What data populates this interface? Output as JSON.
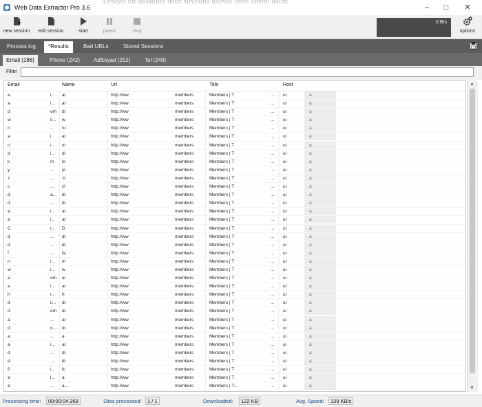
{
  "window": {
    "title": "Web Data Extractor Pro 3.6",
    "background_text": "Örnezii bir doktorun detrr sitvraina bauvur astre onemi decm",
    "minimize_glyph": "–",
    "maximize_glyph": "□",
    "close_glyph": "✕"
  },
  "toolbar": {
    "new_session": "new session",
    "edit_session": "edit session",
    "start": "start",
    "pause": "pause",
    "stop": "stop",
    "speed": "0 B/s",
    "options": "options"
  },
  "main_tabs": [
    {
      "label": "Process log",
      "active": false
    },
    {
      "label": "*Results",
      "active": true
    },
    {
      "label": "Bad URLs",
      "active": false
    },
    {
      "label": "Stored Sessions",
      "active": false
    }
  ],
  "result_tabs": [
    {
      "label": "Email (188)",
      "active": true
    },
    {
      "label": "Phone (242)",
      "active": false
    },
    {
      "label": "AdSoyad (252)",
      "active": false
    },
    {
      "label": "Tel (249)",
      "active": false
    }
  ],
  "filter": {
    "label": "Filter",
    "value": ""
  },
  "grid": {
    "columns": [
      "Email",
      "Name",
      "Url",
      "Title",
      "Host"
    ],
    "rows": [
      {
        "email": "a",
        "e2": "i...",
        "name": "al",
        "url": "http://ww",
        "u2": "members",
        "title": "Members | T",
        "t2": "...",
        "host": "ui",
        "h2": "a"
      },
      {
        "email": "a",
        "e2": "i...",
        "name": "al",
        "url": "http://ww",
        "u2": "members",
        "title": "Members | T",
        "t2": "...",
        "host": "ui",
        "h2": "a"
      },
      {
        "email": "d",
        "e2": "om",
        "name": "di",
        "url": "http://ww",
        "u2": "members",
        "title": "Members | T",
        "t2": "...",
        "host": "ui",
        "h2": "a"
      },
      {
        "email": "w",
        "e2": "il...",
        "name": "w",
        "url": "http://ww",
        "u2": "members",
        "title": "Members | T",
        "t2": "...",
        "host": "ui",
        "h2": "a"
      },
      {
        "email": "n",
        "e2": "...",
        "name": "ni",
        "url": "http://ww",
        "u2": "members",
        "title": "Members | T",
        "t2": "...",
        "host": "ui",
        "h2": "a"
      },
      {
        "email": "a",
        "e2": "i",
        "name": "al",
        "url": "http://ww",
        "u2": "members",
        "title": "Members | T",
        "t2": "...",
        "host": "ui",
        "h2": "a"
      },
      {
        "email": "n",
        "e2": "i...",
        "name": "m",
        "url": "http://ww",
        "u2": "members",
        "title": "Members | T",
        "t2": "...",
        "host": "ui",
        "h2": "a"
      },
      {
        "email": "d",
        "e2": "i...",
        "name": "di",
        "url": "http://ww",
        "u2": "members",
        "title": "Members | T",
        "t2": "...",
        "host": "ui",
        "h2": "a"
      },
      {
        "email": "k",
        "e2": "rn",
        "name": "lo",
        "url": "http://ww",
        "u2": "members",
        "title": "Members | T",
        "t2": "...",
        "host": "ui",
        "h2": "a"
      },
      {
        "email": "y",
        "e2": "...",
        "name": "yi",
        "url": "http://ww",
        "u2": "members",
        "title": "Members | T",
        "t2": "...",
        "host": "ui",
        "h2": "a"
      },
      {
        "email": "z",
        "e2": "...",
        "name": "zi",
        "url": "http://ww",
        "u2": "members",
        "title": "Members | T",
        "t2": "...",
        "host": "ui",
        "h2": "a"
      },
      {
        "email": "c",
        "e2": "...",
        "name": "cl",
        "url": "http://ww",
        "u2": "members",
        "title": "Members | T",
        "t2": "...",
        "host": "ui",
        "h2": "a"
      },
      {
        "email": "d",
        "e2": "a...",
        "name": "di",
        "url": "http://ww",
        "u2": "members",
        "title": "Members | T",
        "t2": "...",
        "host": "ui",
        "h2": "a"
      },
      {
        "email": "d",
        "e2": "...",
        "name": "di",
        "url": "http://ww",
        "u2": "members",
        "title": "Members | T",
        "t2": "...",
        "host": "ui",
        "h2": "a"
      },
      {
        "email": "a",
        "e2": "i...",
        "name": "al",
        "url": "http://ww",
        "u2": "members",
        "title": "Members | T",
        "t2": "...",
        "host": "ui",
        "h2": "a"
      },
      {
        "email": "a",
        "e2": "i...",
        "name": "al",
        "url": "http://ww",
        "u2": "members",
        "title": "Members | T",
        "t2": "...",
        "host": "ui",
        "h2": "a"
      },
      {
        "email": "C",
        "e2": "r...",
        "name": "D",
        "url": "http://ww",
        "u2": "members",
        "title": "Members | T",
        "t2": "...",
        "host": "ui",
        "h2": "a"
      },
      {
        "email": "d",
        "e2": "...",
        "name": "di",
        "url": "http://ww",
        "u2": "members",
        "title": "Members | T",
        "t2": "...",
        "host": "ui",
        "h2": "a"
      },
      {
        "email": "d",
        "e2": "...",
        "name": "di",
        "url": "http://ww",
        "u2": "members",
        "title": "Members | T",
        "t2": "...",
        "host": "ui",
        "h2": "a"
      },
      {
        "email": "f",
        "e2": "...",
        "name": "fa",
        "url": "http://ww",
        "u2": "members",
        "title": "Members | T",
        "t2": "...",
        "host": "ui",
        "h2": "a"
      },
      {
        "email": "n",
        "e2": "i...",
        "name": "m",
        "url": "http://ww",
        "u2": "members",
        "title": "Members | T",
        "t2": "...",
        "host": "ui",
        "h2": "a"
      },
      {
        "email": "w",
        "e2": "i...",
        "name": "w",
        "url": "http://ww",
        "u2": "members",
        "title": "Members | T",
        "t2": "...",
        "host": "ui",
        "h2": "a"
      },
      {
        "email": "a",
        "e2": "om",
        "name": "al",
        "url": "http://ww",
        "u2": "members",
        "title": "Members | T",
        "t2": "...",
        "host": "ui",
        "h2": "a"
      },
      {
        "email": "a",
        "e2": "i...",
        "name": "al",
        "url": "http://ww",
        "u2": "members",
        "title": "Members | T",
        "t2": "...",
        "host": "ui",
        "h2": "a"
      },
      {
        "email": "h",
        "e2": "r...",
        "name": "h",
        "url": "http://ww",
        "u2": "members",
        "title": "Members | T",
        "t2": "...",
        "host": "ui",
        "h2": "a"
      },
      {
        "email": "d",
        "e2": "il...",
        "name": "di",
        "url": "http://ww",
        "u2": "members",
        "title": "Members | T",
        "t2": "...",
        "host": "ui",
        "h2": "a"
      },
      {
        "email": "d",
        "e2": "om",
        "name": "di",
        "url": "http://ww",
        "u2": "members",
        "title": "Members | T",
        "t2": "...",
        "host": "ui",
        "h2": "a"
      },
      {
        "email": "a",
        "e2": "...",
        "name": "al",
        "url": "http://ww",
        "u2": "members",
        "title": "Members | T",
        "t2": "...",
        "host": "ui",
        "h2": "a"
      },
      {
        "email": "d",
        "e2": "n...",
        "name": "di",
        "url": "http://ww",
        "u2": "members",
        "title": "Members | T",
        "t2": "...",
        "host": "ui",
        "h2": "a"
      },
      {
        "email": "a",
        "e2": "...",
        "name": "a",
        "url": "http://ww",
        "u2": "members",
        "title": "Members | T",
        "t2": "...",
        "host": "ui",
        "h2": "a"
      },
      {
        "email": "a",
        "e2": "i...",
        "name": "al",
        "url": "http://ww",
        "u2": "members",
        "title": "Members | T",
        "t2": "...",
        "host": "ui",
        "h2": "a"
      },
      {
        "email": "d",
        "e2": "...",
        "name": "di",
        "url": "http://ww",
        "u2": "members",
        "title": "Members | T",
        "t2": "...",
        "host": "ui",
        "h2": "a"
      },
      {
        "email": "d",
        "e2": "...",
        "name": "di",
        "url": "http://ww",
        "u2": "members",
        "title": "Members | T",
        "t2": "...",
        "host": "ui",
        "h2": "a"
      },
      {
        "email": "fi",
        "e2": "i...",
        "name": "fc",
        "url": "http://ww",
        "u2": "members",
        "title": "Members | T",
        "t2": "...",
        "host": "ui",
        "h2": "a"
      },
      {
        "email": "a",
        "e2": "l...",
        "name": "a",
        "url": "http://ww",
        "u2": "members",
        "title": "Members | T",
        "t2": "...",
        "host": "ui",
        "h2": "a"
      },
      {
        "email": "a",
        "e2": "...",
        "name": "a...",
        "url": "http://ww",
        "u2": "members",
        "title": "Members | T...",
        "t2": "...",
        "host": "ui",
        "h2": "a"
      }
    ]
  },
  "status": {
    "processing_time_label": "Processing time:",
    "processing_time": "00:00:04.369",
    "sites_processed_label": "Sites processed:",
    "sites_processed": "1 / 1",
    "downloaded_label": "Downloaded:",
    "downloaded": "122 KB",
    "avg_speed_label": "Avg. Speed:",
    "avg_speed": "139 KB/s"
  },
  "colors": {
    "tab_bar": "#5c5c5c",
    "result_tab_bar": "#6a6a6a",
    "speed_box": "#4a4a4a",
    "status_label": "#1f4e8c"
  }
}
